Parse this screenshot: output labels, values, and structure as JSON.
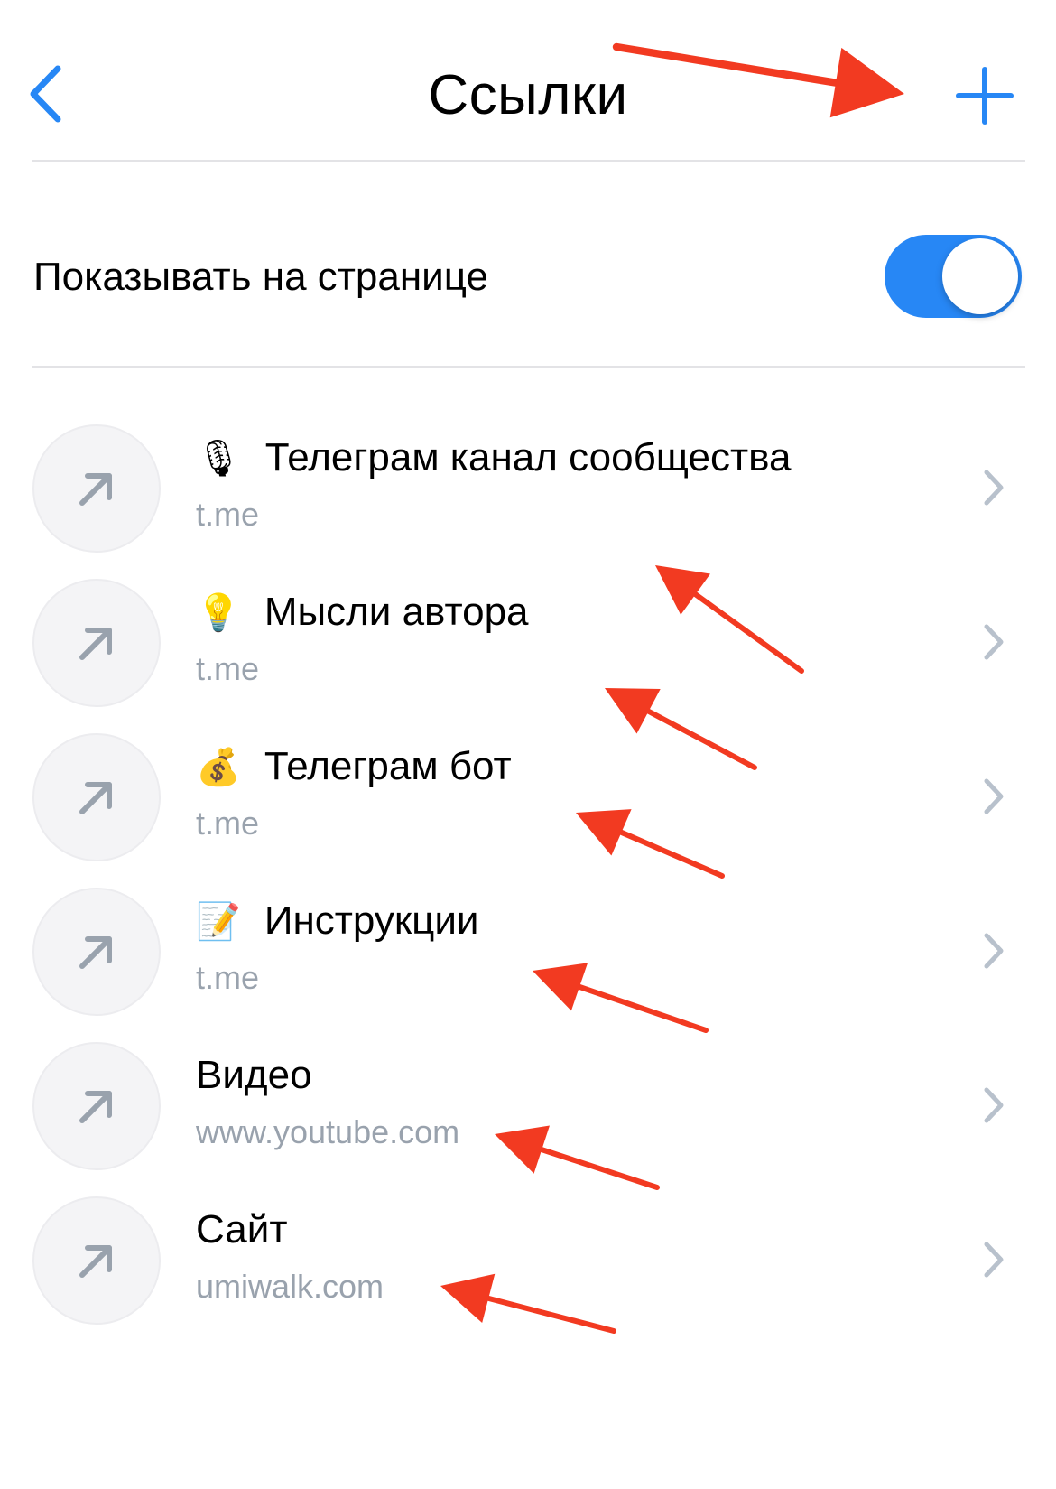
{
  "header": {
    "title": "Ссылки"
  },
  "settings": {
    "show_on_page_label": "Показывать на странице",
    "show_on_page_enabled": true
  },
  "links": [
    {
      "emoji": "🎙",
      "title": "Телеграм канал сообщества",
      "url": "t.me"
    },
    {
      "emoji": "💡",
      "title": "Мысли автора",
      "url": "t.me"
    },
    {
      "emoji": "💰",
      "title": "Телеграм бот",
      "url": "t.me"
    },
    {
      "emoji": "📝",
      "title": "Инструкции",
      "url": "t.me"
    },
    {
      "emoji": "",
      "title": "Видео",
      "url": "www.youtube.com"
    },
    {
      "emoji": "",
      "title": "Сайт",
      "url": "umiwalk.com"
    }
  ],
  "icons": {
    "back": "chevron-left-icon",
    "add": "plus-icon",
    "link": "arrow-up-right-icon",
    "row_chevron": "chevron-right-icon"
  },
  "colors": {
    "accent": "#2787f5",
    "secondary_text": "#99a2ad",
    "icon_gray": "#99a2ad",
    "annotation_arrow": "#f23a21"
  }
}
